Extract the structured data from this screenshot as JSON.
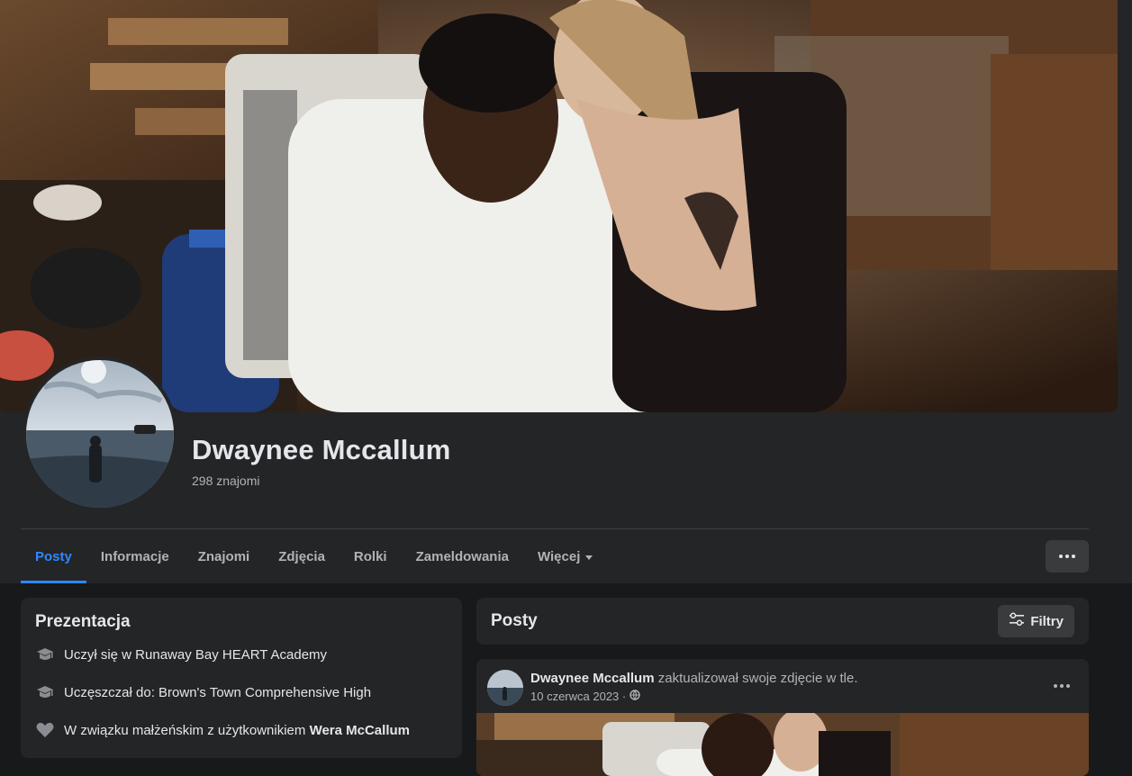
{
  "profile": {
    "name": "Dwaynee Mccallum",
    "friends": "298 znajomi"
  },
  "tabs": [
    {
      "label": "Posty",
      "active": true
    },
    {
      "label": "Informacje"
    },
    {
      "label": "Znajomi"
    },
    {
      "label": "Zdjęcia"
    },
    {
      "label": "Rolki"
    },
    {
      "label": "Zameldowania"
    },
    {
      "label": "Więcej"
    }
  ],
  "intro": {
    "title": "Prezentacja",
    "rows": [
      {
        "icon": "graduation-cap-icon",
        "text": "Uczył się w Runaway Bay HEART Academy"
      },
      {
        "icon": "graduation-cap-icon",
        "text": "Uczęszczał do: Brown's Town Comprehensive High"
      },
      {
        "icon": "heart-icon",
        "text": "W związku małżeńskim z użytkownikiem ",
        "strong": "Wera McCallum"
      }
    ]
  },
  "posts": {
    "title": "Posty",
    "filter_label": "Filtry"
  },
  "post": {
    "author": "Dwaynee Mccallum",
    "action": " zaktualizował swoje zdjęcie w tle.",
    "date": "10 czerwca 2023 ·",
    "privacy_icon": "globe-icon"
  },
  "colors": {
    "accent": "#2d88ff",
    "background": "#18191a",
    "card": "#242526",
    "button": "#3a3b3c"
  }
}
